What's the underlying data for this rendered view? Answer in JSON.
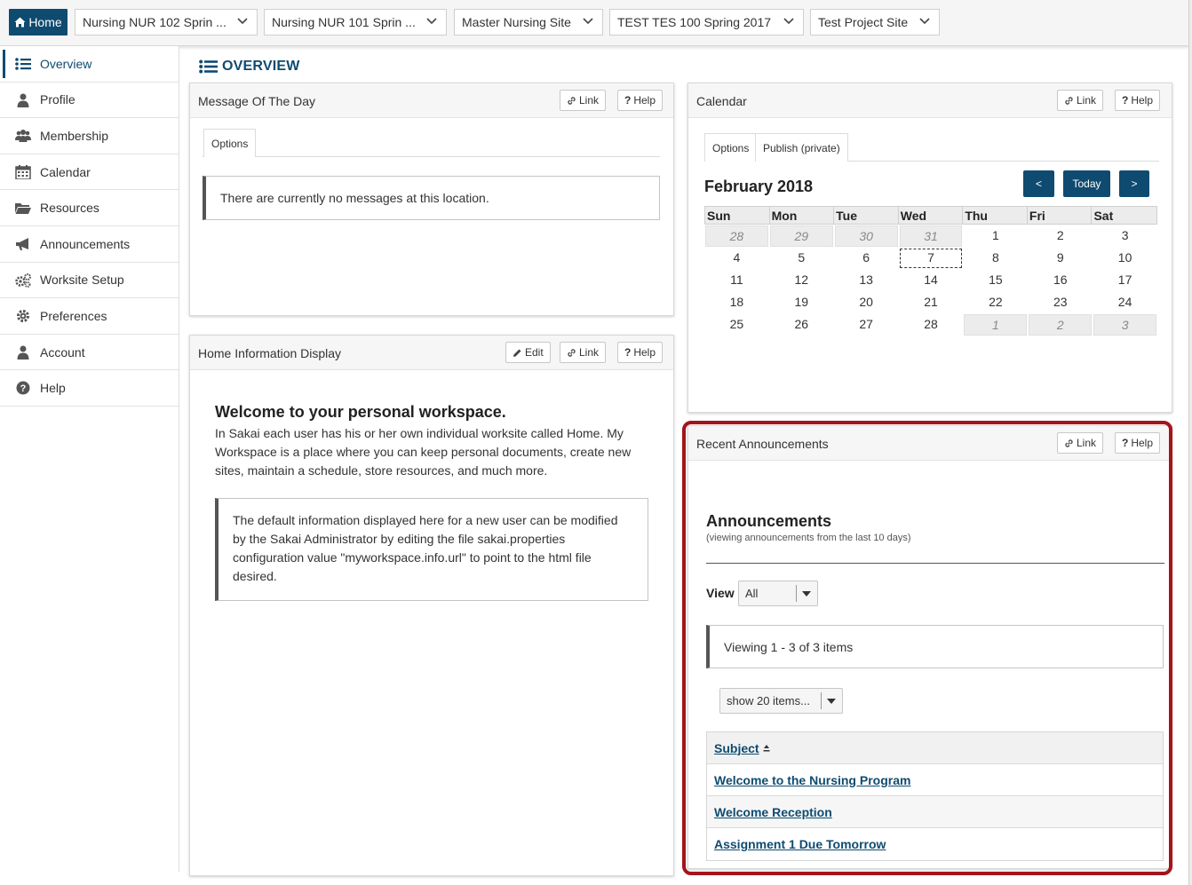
{
  "topbar": {
    "home_label": "Home",
    "sites": [
      {
        "label": "Nursing NUR 102 Sprin ..."
      },
      {
        "label": "Nursing NUR 101 Sprin ..."
      },
      {
        "label": "Master Nursing Site"
      },
      {
        "label": "TEST TES 100 Spring 2017"
      },
      {
        "label": "Test Project Site"
      }
    ]
  },
  "nav": {
    "items": [
      {
        "label": "Overview",
        "icon": "list-icon"
      },
      {
        "label": "Profile",
        "icon": "user-icon"
      },
      {
        "label": "Membership",
        "icon": "users-icon"
      },
      {
        "label": "Calendar",
        "icon": "calendar-icon"
      },
      {
        "label": "Resources",
        "icon": "folder-icon"
      },
      {
        "label": "Announcements",
        "icon": "megaphone-icon"
      },
      {
        "label": "Worksite Setup",
        "icon": "cogs-icon"
      },
      {
        "label": "Preferences",
        "icon": "gear-icon"
      },
      {
        "label": "Account",
        "icon": "user-icon"
      },
      {
        "label": "Help",
        "icon": "help-icon"
      }
    ]
  },
  "page_title": "OVERVIEW",
  "buttons": {
    "link": "Link",
    "help": "Help",
    "edit": "Edit"
  },
  "motd": {
    "title": "Message Of The Day",
    "options_tab": "Options",
    "message": "There are currently no messages at this location."
  },
  "home_info": {
    "title": "Home Information Display",
    "heading": "Welcome to your personal workspace.",
    "paragraph": "In Sakai each user has his or her own individual worksite called Home. My Workspace is a place where you can keep personal documents, create new sites, maintain a schedule, store resources, and much more.",
    "note": "The default information displayed here for a new user can be modified by the Sakai Administrator by editing the file sakai.properties configuration value \"myworkspace.info.url\" to point to the html file desired."
  },
  "calendar": {
    "title": "Calendar",
    "tabs": [
      "Options",
      "Publish (private)"
    ],
    "month": "February 2018",
    "prev_label": "<",
    "today_label": "Today",
    "next_label": ">",
    "weekdays": [
      "Sun",
      "Mon",
      "Tue",
      "Wed",
      "Thu",
      "Fri",
      "Sat"
    ],
    "weeks": [
      [
        "28",
        "29",
        "30",
        "31",
        "1",
        "2",
        "3"
      ],
      [
        "4",
        "5",
        "6",
        "7",
        "8",
        "9",
        "10"
      ],
      [
        "11",
        "12",
        "13",
        "14",
        "15",
        "16",
        "17"
      ],
      [
        "18",
        "19",
        "20",
        "21",
        "22",
        "23",
        "24"
      ],
      [
        "25",
        "26",
        "27",
        "28",
        "1",
        "2",
        "3"
      ]
    ]
  },
  "announcements": {
    "panel_title": "Recent Announcements",
    "heading": "Announcements",
    "subheading": "(viewing announcements from the last 10 days)",
    "view_label": "View",
    "view_value": "All",
    "viewing_text": "Viewing 1 - 3 of 3 items",
    "page_size": "show 20 items...",
    "subject_header": "Subject",
    "items": [
      "Welcome to the Nursing Program",
      "Welcome Reception",
      "Assignment 1 Due Tomorrow"
    ]
  },
  "colors": {
    "accent": "#0f4b70",
    "highlight": "#a4141b"
  }
}
